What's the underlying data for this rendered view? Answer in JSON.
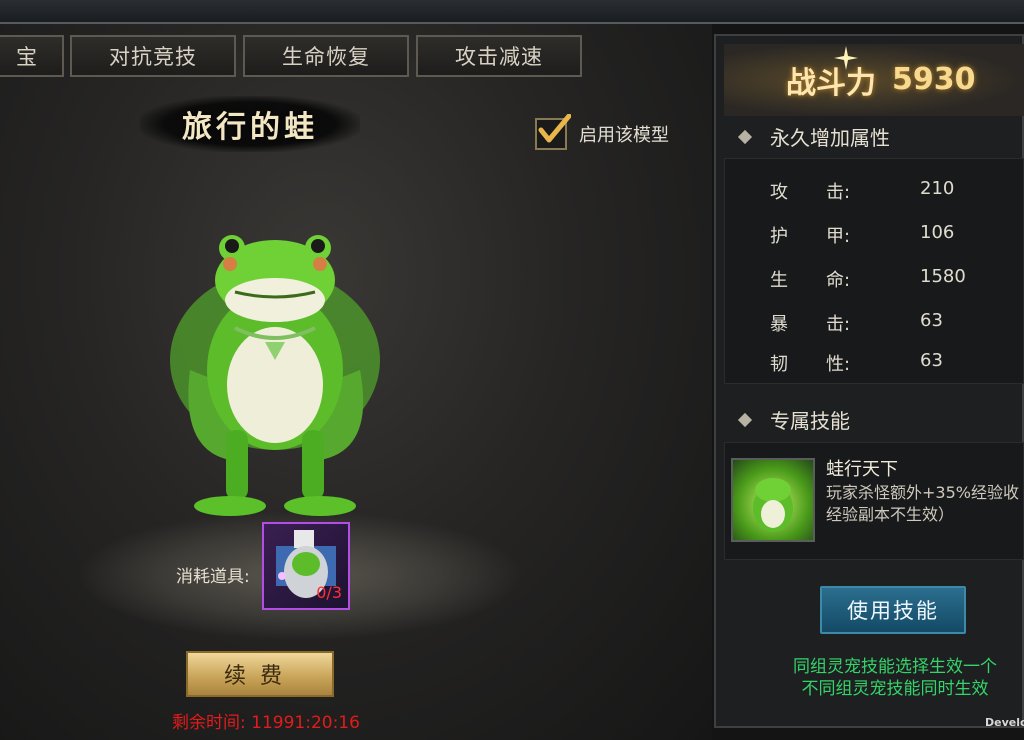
{
  "tabs": [
    {
      "label": "宝"
    },
    {
      "label": "对抗竞技"
    },
    {
      "label": "生命恢复"
    },
    {
      "label": "攻击减速"
    }
  ],
  "pet": {
    "name": "旅行的蛙"
  },
  "model_toggle": {
    "label": "启用该模型",
    "checked": true
  },
  "consumable": {
    "label": "消耗道具:",
    "count": "0/3"
  },
  "renew_button": {
    "label": "续费"
  },
  "time_left": "剩余时间: 11991:20:16",
  "power": {
    "label": "战斗力",
    "value": "5930"
  },
  "permanent_attrs": {
    "heading": "永久增加属性",
    "rows": [
      {
        "k1": "攻",
        "k2": "击:",
        "value": "210"
      },
      {
        "k1": "护",
        "k2": "甲:",
        "value": "106"
      },
      {
        "k1": "生",
        "k2": "命:",
        "value": "1580"
      },
      {
        "k1": "暴",
        "k2": "击:",
        "value": "63"
      },
      {
        "k1": "韧",
        "k2": "性:",
        "value": "63"
      }
    ]
  },
  "exclusive_skill": {
    "heading": "专属技能",
    "name": "蛙行天下",
    "desc_line1": "玩家杀怪额外+35%经验收",
    "desc_line2": "经验副本不生效）",
    "use_button": "使用技能"
  },
  "note_line1": "同组灵宠技能选择生效一个",
  "note_line2": "不同组灵宠技能同时生效",
  "watermark": "Develop"
}
